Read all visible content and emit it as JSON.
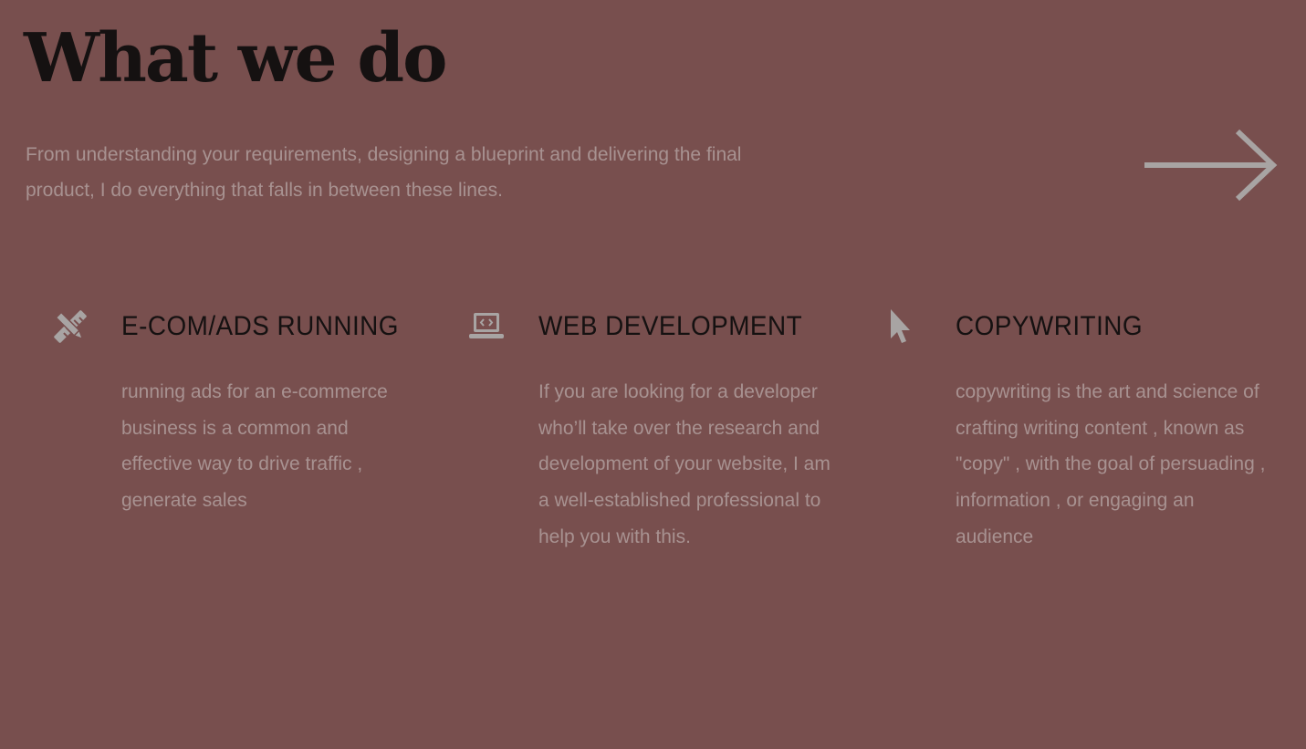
{
  "header": {
    "title": "What we do",
    "intro": "From understanding your requirements, designing a blueprint and delivering the final product, I do everything that falls in between these lines.",
    "next_icon": "arrow-right-icon"
  },
  "colors": {
    "background": "#784f4e",
    "heading": "#151111",
    "body_text": "#a89291",
    "icon": "#a8a4a3"
  },
  "services": [
    {
      "icon": "pencil-ruler-icon",
      "title": "E-COM/ADS RUNNING",
      "description": "running ads for an e-commerce business is a common and effective way to drive traffic , generate sales"
    },
    {
      "icon": "laptop-code-icon",
      "title": "WEB DEVELOPMENT",
      "description": "If you are looking for a developer who’ll take over the research and development of your website, I am a well-established professional to help you with this."
    },
    {
      "icon": "mouse-pointer-icon",
      "title": "COPYWRITING",
      "description": "copywriting is the art and science of crafting writing content , known as \"copy\" , with the goal of persuading , information , or engaging an audience"
    }
  ]
}
